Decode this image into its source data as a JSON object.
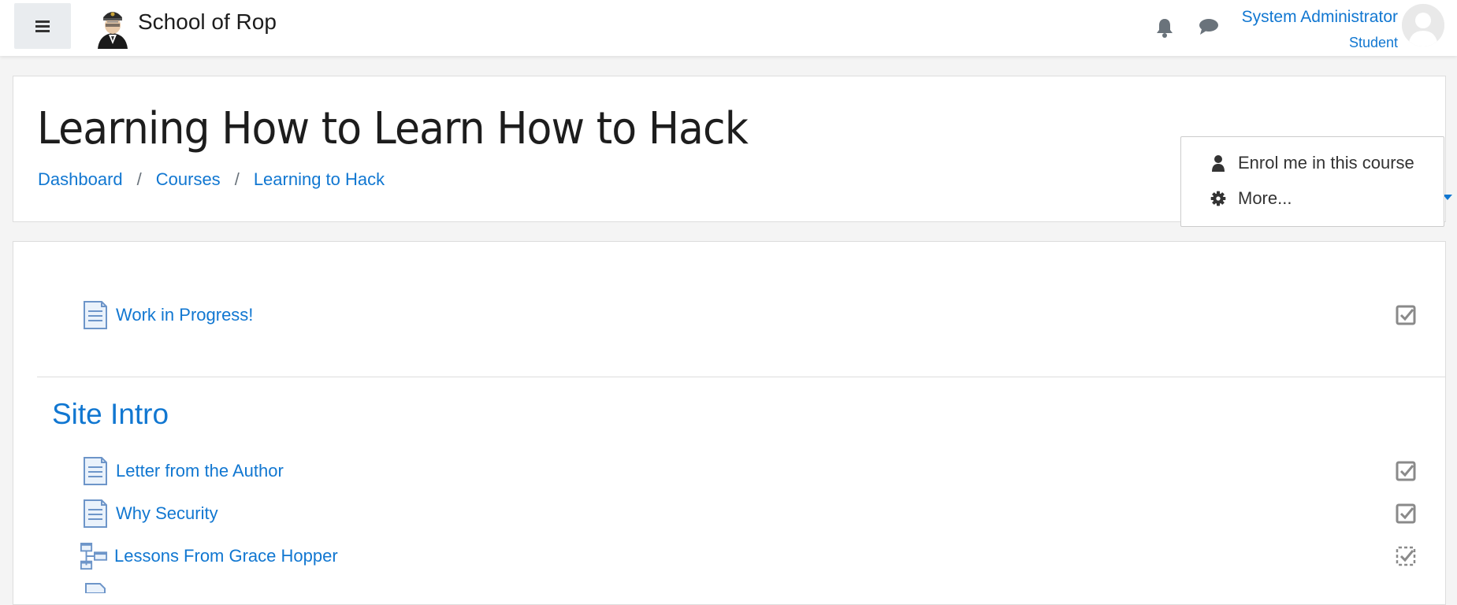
{
  "navbar": {
    "site_name": "School of Rop",
    "user_name": "System Administrator",
    "user_role": "Student"
  },
  "header": {
    "title": "Learning How to Learn How to Hack",
    "breadcrumb": [
      "Dashboard",
      "Courses",
      "Learning to Hack"
    ],
    "breadcrumb_sep": "/"
  },
  "dropdown": {
    "items": [
      {
        "label": "Enrol me in this course",
        "icon": "user-icon"
      },
      {
        "label": "More...",
        "icon": "gear-icon"
      }
    ]
  },
  "content": {
    "top_activity": {
      "label": "Work in Progress!",
      "icon": "page-icon"
    },
    "section": {
      "title": "Site Intro",
      "activities": [
        {
          "label": "Letter from the Author",
          "icon": "page-icon"
        },
        {
          "label": "Why Security",
          "icon": "page-icon"
        },
        {
          "label": "Lessons From Grace Hopper",
          "icon": "book-icon"
        }
      ]
    }
  },
  "colors": {
    "link": "#1177d1",
    "background": "#f4f4f4"
  }
}
